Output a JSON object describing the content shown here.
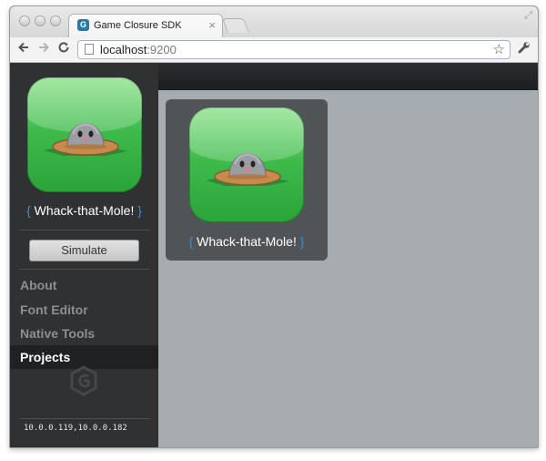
{
  "browser": {
    "tab_title": "Game Closure SDK",
    "tab_close": "×",
    "url_host": "localhost",
    "url_port": ":9200"
  },
  "icons": {
    "back": "arrow-left-icon",
    "forward": "arrow-right-icon",
    "reload": "reload-icon",
    "star": "star-icon",
    "wrench": "wrench-icon"
  },
  "sidebar": {
    "project_name": "Whack-that-Mole!",
    "simulate_label": "Simulate",
    "menu": [
      {
        "label": "About",
        "active": false
      },
      {
        "label": "Font Editor",
        "active": false
      },
      {
        "label": "Native Tools",
        "active": false
      },
      {
        "label": "Projects",
        "active": true
      }
    ],
    "ip_addresses": "10.0.0.119,10.0.0.182"
  },
  "main": {
    "projects": [
      {
        "name": "Whack-that-Mole!"
      }
    ]
  },
  "colors": {
    "sidebar_bg": "#2f3133",
    "main_bg": "#a6acaf",
    "card_bg": "#505456",
    "brace_accent": "#3d8fd6",
    "icon_green": "#3fbb4c"
  }
}
